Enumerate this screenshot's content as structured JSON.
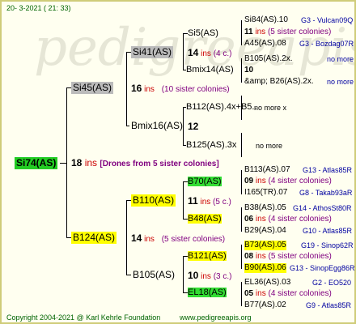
{
  "header": {
    "date": "20- 3-2021 ( 21: 33)"
  },
  "footer": {
    "copyright": "Copyright 2004-2021 @ Karl Kehrle Foundation",
    "url": "www.pedigreeapis.org"
  },
  "root": {
    "id": "Si74(AS)",
    "num": "18",
    "ins": "ins",
    "note": "[Drones from 5 sister colonies]"
  },
  "sire": {
    "id": "Si45(AS)",
    "num": "16",
    "ins": "ins",
    "note": "(10 sister colonies)"
  },
  "dam": {
    "id": "B124(AS)",
    "num": "14",
    "ins": "ins",
    "note": "(5 sister colonies)"
  },
  "sire_sire": {
    "id": "Si41(AS)",
    "num": "14",
    "ins": "ins",
    "note": "(4 c.)"
  },
  "sire_dam": {
    "id": "Bmix16(AS)",
    "num": "12"
  },
  "dam_sire": {
    "id": "B110(AS)",
    "num": "11",
    "ins": "ins",
    "note": "(5 c.)"
  },
  "dam_dam": {
    "id": "B105(AS)",
    "num": "10",
    "ins": "ins",
    "note": "(3 c.)"
  },
  "g3": {
    "si5": {
      "id": "Si5(AS)"
    },
    "bmix14": {
      "id": "Bmix14(AS)",
      "num": "10"
    },
    "b112": {
      "id": "B112(AS).4x+B5..",
      "extra": "no more x"
    },
    "b125": {
      "id": "B125(AS).3x",
      "extra": "no more"
    },
    "b70": {
      "id": "B70(AS)",
      "num": "09",
      "ins": "ins",
      "note": "(4 sister colonies)"
    },
    "b48": {
      "id": "B48(AS)",
      "num": "06",
      "ins": "ins",
      "note": "(4 sister colonies)"
    },
    "b121": {
      "id": "B121(AS)",
      "num": "08",
      "ins": "ins",
      "note": "(5 sister colonies)"
    },
    "el18": {
      "id": "EL18(AS)",
      "num": "05",
      "ins": "ins",
      "note": "(4 sister colonies)"
    }
  },
  "g4": {
    "si84": {
      "id": "Si84(AS).10",
      "link": "G3 - Vulcan09Q"
    },
    "si84_num": "11",
    "si84_ins": "ins",
    "si84_note": "(5 sister colonies)",
    "a45": {
      "id": "A45(AS).08",
      "link": "G3 - Bozdag07R"
    },
    "b105x": {
      "id": "B105(AS).2x.",
      "link": "no more"
    },
    "b26": {
      "id": "&amp; B26(AS).2x.",
      "link": "no more"
    },
    "b113": {
      "id": "B113(AS).07",
      "link": "G13 - Atlas85R"
    },
    "i165": {
      "id": "I165(TR).07",
      "link": "G8 - Takab93aR"
    },
    "b38": {
      "id": "B38(AS).05",
      "link": "G14 - AthosSt80R"
    },
    "b29": {
      "id": "B29(AS).04",
      "link": "G10 - Atlas85R"
    },
    "b73": {
      "id": "B73(AS).05",
      "link": "G19 - Sinop62R"
    },
    "b90": {
      "id": "B90(AS).06",
      "link": "G13 - SinopEgg86R"
    },
    "el36": {
      "id": "EL36(AS).03",
      "link": "G2 - EO520"
    },
    "b77": {
      "id": "B77(AS).02",
      "link": "G9 - Atlas85R"
    }
  }
}
